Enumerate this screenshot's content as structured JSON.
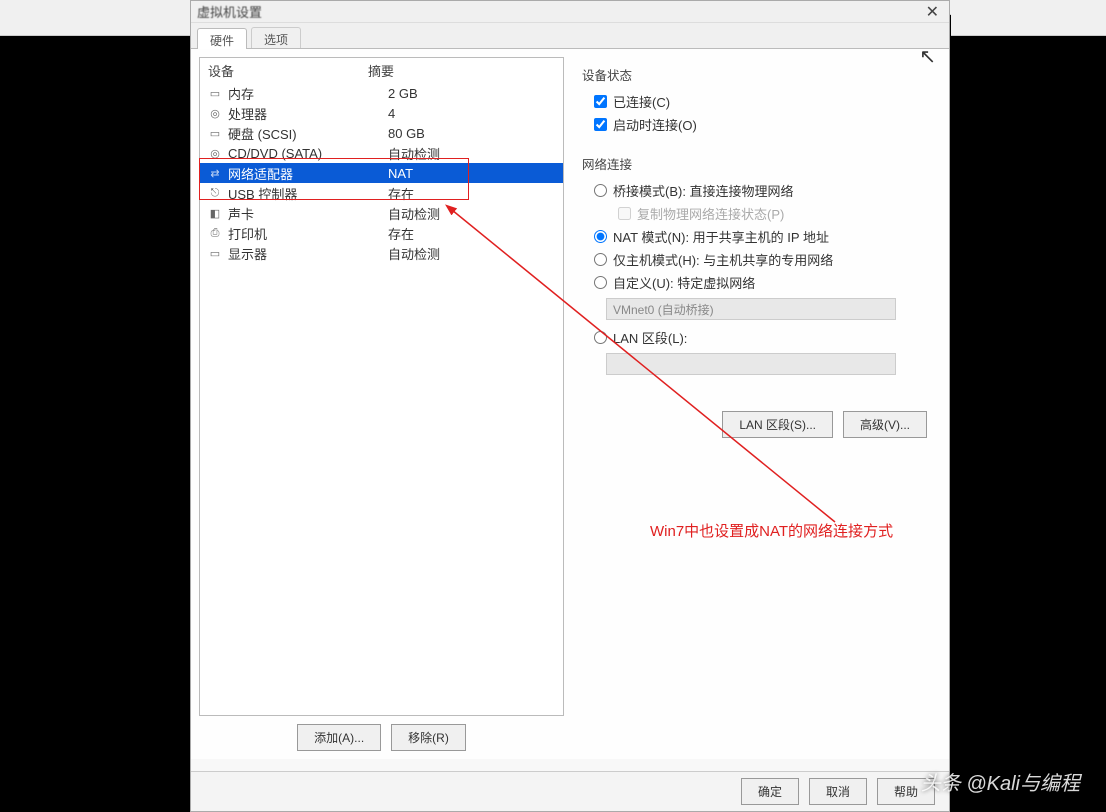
{
  "titlebar": {
    "title": "虚拟机设置",
    "close": "✕"
  },
  "tabs": {
    "hardware": "硬件",
    "options": "选项"
  },
  "device_header": {
    "name": "设备",
    "summary": "摘要"
  },
  "devices": [
    {
      "icon": "▭",
      "name": "内存",
      "value": "2 GB"
    },
    {
      "icon": "◎",
      "name": "处理器",
      "value": "4"
    },
    {
      "icon": "▭",
      "name": "硬盘 (SCSI)",
      "value": "80 GB"
    },
    {
      "icon": "◎",
      "name": "CD/DVD (SATA)",
      "value": "自动检测"
    },
    {
      "icon": "⇄",
      "name": "网络适配器",
      "value": "NAT"
    },
    {
      "icon": "⎋",
      "name": "USB 控制器",
      "value": "存在"
    },
    {
      "icon": "◧",
      "name": "声卡",
      "value": "自动检测"
    },
    {
      "icon": "⎙",
      "name": "打印机",
      "value": "存在"
    },
    {
      "icon": "▭",
      "name": "显示器",
      "value": "自动检测"
    }
  ],
  "left_btns": {
    "add": "添加(A)...",
    "remove": "移除(R)"
  },
  "rp": {
    "device_status": "设备状态",
    "connected": "已连接(C)",
    "connect_at_poweron": "启动时连接(O)",
    "net_connection": "网络连接",
    "bridged": "桥接模式(B): 直接连接物理网络",
    "replicate": "复制物理网络连接状态(P)",
    "nat": "NAT 模式(N): 用于共享主机的 IP 地址",
    "hostonly": "仅主机模式(H): 与主机共享的专用网络",
    "custom": "自定义(U): 特定虚拟网络",
    "vmnet": "VMnet0 (自动桥接)",
    "lanseg": "LAN 区段(L):",
    "lanseg_btn": "LAN 区段(S)...",
    "advanced_btn": "高级(V)..."
  },
  "footer": {
    "ok": "确定",
    "cancel": "取消",
    "help": "帮助"
  },
  "annotation_text": "Win7中也设置成NAT的网络连接方式",
  "watermark": "头条 @Kali与编程"
}
